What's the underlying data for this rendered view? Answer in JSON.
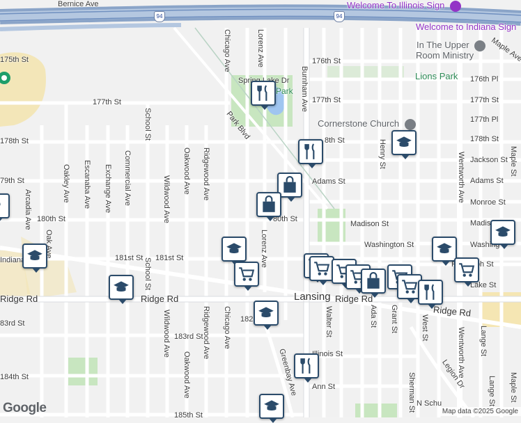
{
  "roads_h": [
    {
      "label": "Bernice Ave"
    },
    {
      "label": "175th St"
    },
    {
      "label": "176th St"
    },
    {
      "label": "177th St"
    },
    {
      "label": "177th St"
    },
    {
      "label": "178th St"
    },
    {
      "label": "79th St"
    },
    {
      "label": "180th St"
    },
    {
      "label": "181st St"
    },
    {
      "label": "Ridge Rd"
    },
    {
      "label": "Ridge Rd"
    },
    {
      "label": "83rd St"
    },
    {
      "label": "183rd St"
    },
    {
      "label": "184th St"
    },
    {
      "label": "185th St"
    },
    {
      "label": "Adams St"
    },
    {
      "label": "80th St"
    },
    {
      "label": "Madison St"
    },
    {
      "label": "Washington St"
    },
    {
      "label": "Illinois St"
    },
    {
      "label": "Ann St"
    },
    {
      "label": "176th Pl"
    },
    {
      "label": "177th St"
    },
    {
      "label": "177th Pl"
    },
    {
      "label": "178th St"
    },
    {
      "label": "Jackson St"
    },
    {
      "label": "Adams St"
    },
    {
      "label": "Monroe St"
    },
    {
      "label": "Madis"
    },
    {
      "label": "Washing"
    },
    {
      "label": "Randolph St"
    },
    {
      "label": "Lake St"
    },
    {
      "label": "Ridge Rd"
    },
    {
      "label": "182"
    },
    {
      "label": "Indiana"
    },
    {
      "label": "8th St"
    }
  ],
  "roads_v": [
    {
      "label": "Chicago Ave"
    },
    {
      "label": "Lorenz Ave"
    },
    {
      "label": "Burnham Ave"
    },
    {
      "label": "Park Blvd"
    },
    {
      "label": "School St"
    },
    {
      "label": "Oakwood Ave"
    },
    {
      "label": "Ridgewood Ave"
    },
    {
      "label": "Commercial Ave"
    },
    {
      "label": "Escanaba Ave"
    },
    {
      "label": "Exchange Ave"
    },
    {
      "label": "Oakley Ave"
    },
    {
      "label": "Arcadia Ave"
    },
    {
      "label": "Wildwood Ave"
    },
    {
      "label": "Oak Ave"
    },
    {
      "label": "School St"
    },
    {
      "label": "Wildwood Ave"
    },
    {
      "label": "Ridgewood Ave"
    },
    {
      "label": "Oakwood Ave"
    },
    {
      "label": "Chicago Ave"
    },
    {
      "label": "Lorenz Ave"
    },
    {
      "label": "Greenbay Ave"
    },
    {
      "label": "Henry St"
    },
    {
      "label": "Wentworth Ave"
    },
    {
      "label": "Wentworth Ave"
    },
    {
      "label": "Maple St"
    },
    {
      "label": "Maple St"
    },
    {
      "label": "Walter St"
    },
    {
      "label": "Ada St"
    },
    {
      "label": "Grant St"
    },
    {
      "label": "Sherman St"
    },
    {
      "label": "West St"
    },
    {
      "label": "Legion Dr"
    },
    {
      "label": "N Schu"
    },
    {
      "label": "Lange St"
    },
    {
      "label": "Lange St"
    },
    {
      "label": "Maple Ave"
    },
    {
      "label": "Spring Lake Dr"
    }
  ],
  "pois": [
    {
      "label": "Welcome To Illinois Sign",
      "icon": "landmark-icon",
      "color": "#9334c6"
    },
    {
      "label": "Welcome to Indiana Sign",
      "icon": "landmark-icon",
      "color": "#9334c6"
    },
    {
      "label": "In The Upper",
      "icon": "museum-icon",
      "color": "#5f6368"
    },
    {
      "label": "Room Ministry",
      "icon": "",
      "color": "#5f6368"
    },
    {
      "label": "Lions Park",
      "icon": "park-icon",
      "color": "#2e8b57"
    },
    {
      "label": "Cornerstone Church",
      "icon": "church-icon",
      "color": "#5f6368"
    },
    {
      "label": "Lansing",
      "icon": "",
      "color": "#333333"
    },
    {
      "label": "Park",
      "icon": "park-icon",
      "color": "#2e8b57"
    }
  ],
  "shields": [
    {
      "label": "94"
    },
    {
      "label": "94"
    }
  ],
  "markers": [
    {
      "type": "restaurant",
      "icon": "restaurant-icon"
    },
    {
      "type": "school",
      "icon": "school-icon"
    },
    {
      "type": "restaurant",
      "icon": "restaurant-icon"
    },
    {
      "type": "shopping",
      "icon": "shopping-bag-icon"
    },
    {
      "type": "shopping",
      "icon": "shopping-bag-icon"
    },
    {
      "type": "school",
      "icon": "school-icon"
    },
    {
      "type": "school",
      "icon": "school-icon"
    },
    {
      "type": "school",
      "icon": "school-icon"
    },
    {
      "type": "school",
      "icon": "school-icon"
    },
    {
      "type": "grocery",
      "icon": "shopping-cart-icon"
    },
    {
      "type": "school",
      "icon": "school-icon"
    },
    {
      "type": "grocery",
      "icon": "shopping-cart-icon"
    },
    {
      "type": "grocery",
      "icon": "shopping-cart-icon"
    },
    {
      "type": "grocery",
      "icon": "shopping-cart-icon"
    },
    {
      "type": "grocery",
      "icon": "shopping-cart-icon"
    },
    {
      "type": "shopping",
      "icon": "shopping-bag-icon"
    },
    {
      "type": "grocery",
      "icon": "shopping-cart-icon"
    },
    {
      "type": "grocery",
      "icon": "shopping-cart-icon"
    },
    {
      "type": "restaurant",
      "icon": "restaurant-icon"
    },
    {
      "type": "grocery",
      "icon": "shopping-cart-icon"
    },
    {
      "type": "restaurant",
      "icon": "restaurant-icon"
    },
    {
      "type": "school",
      "icon": "school-icon"
    },
    {
      "type": "shopping",
      "icon": "shopping-bag-icon"
    }
  ],
  "attribution": {
    "logo": "Google",
    "credit": "Map data ©2025 Google"
  }
}
